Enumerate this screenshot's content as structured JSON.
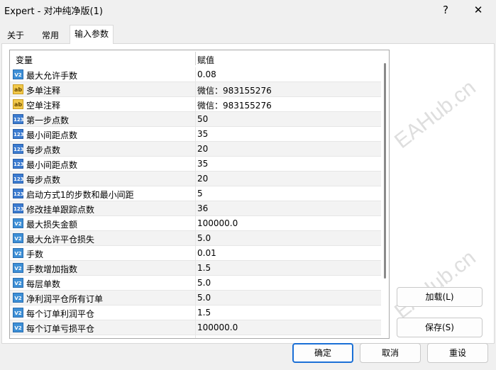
{
  "window": {
    "title": "Expert - 对冲纯净版(1)",
    "help_glyph": "?",
    "close_glyph": "✕"
  },
  "tabs": [
    {
      "label": "关于"
    },
    {
      "label": "常用"
    },
    {
      "label": "输入参数"
    }
  ],
  "grid": {
    "headers": {
      "variable": "变量",
      "value": "赋值"
    },
    "rows": [
      {
        "type": "double",
        "icon_text": "V2",
        "name": "最大允许手数",
        "value": "0.08"
      },
      {
        "type": "string",
        "icon_text": "ab",
        "name": "多单注释",
        "value": "微信：983155276"
      },
      {
        "type": "string",
        "icon_text": "ab",
        "name": "空单注释",
        "value": "微信：983155276"
      },
      {
        "type": "int",
        "icon_text": "123",
        "name": "第一步点数",
        "value": "50"
      },
      {
        "type": "int",
        "icon_text": "123",
        "name": "最小间距点数",
        "value": "35"
      },
      {
        "type": "int",
        "icon_text": "123",
        "name": "每步点数",
        "value": "20"
      },
      {
        "type": "int",
        "icon_text": "123",
        "name": "最小间距点数",
        "value": "35"
      },
      {
        "type": "int",
        "icon_text": "123",
        "name": "每步点数",
        "value": "20"
      },
      {
        "type": "int",
        "icon_text": "123",
        "name": "启动方式1的步数和最小间距",
        "value": "5"
      },
      {
        "type": "int",
        "icon_text": "123",
        "name": "修改挂单跟踪点数",
        "value": "36"
      },
      {
        "type": "double",
        "icon_text": "V2",
        "name": "最大损失金额",
        "value": "100000.0"
      },
      {
        "type": "double",
        "icon_text": "V2",
        "name": "最大允许平仓损失",
        "value": "5.0"
      },
      {
        "type": "double",
        "icon_text": "V2",
        "name": "手数",
        "value": "0.01"
      },
      {
        "type": "double",
        "icon_text": "V2",
        "name": "手数增加指数",
        "value": "1.5"
      },
      {
        "type": "double",
        "icon_text": "V2",
        "name": "每层单数",
        "value": "5.0"
      },
      {
        "type": "double",
        "icon_text": "V2",
        "name": "净利润平仓所有订单",
        "value": "5.0"
      },
      {
        "type": "double",
        "icon_text": "V2",
        "name": "每个订单利润平仓",
        "value": "1.5"
      },
      {
        "type": "double",
        "icon_text": "V2",
        "name": "每个订单亏损平仓",
        "value": "100000.0"
      }
    ]
  },
  "buttons": {
    "load": "加载(L)",
    "save": "保存(S)",
    "ok": "确定",
    "cancel": "取消",
    "reset": "重设"
  },
  "watermarks": [
    "EAHub.cn",
    "EAHub.cn",
    "EAHub.cn",
    "EAHub.cn",
    "EAHub.cn",
    "EAHub.cn"
  ],
  "colors": {
    "accent": "#1a6fd6",
    "alt_row": "#f3f3f3"
  }
}
